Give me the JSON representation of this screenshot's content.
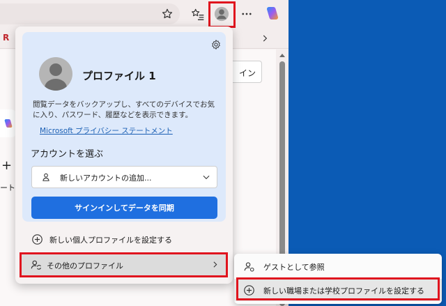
{
  "toolbar": {
    "bookmark_left_letter": "R"
  },
  "page": {
    "signin_fragment": "イン",
    "plus_symbol": "+",
    "side_fragment": "ート"
  },
  "flyout": {
    "profile_name": "プロファイル 1",
    "description": "閲覧データをバックアップし、すべてのデバイスでお気に入り、パスワード、履歴などを表示できます。",
    "privacy_link": "Microsoft プライバシー ステートメント",
    "account_label": "アカウントを選ぶ",
    "account_select_value": "新しいアカウントの追加...",
    "signin_button": "サインインしてデータを同期",
    "new_personal_profile": "新しい個人プロファイルを設定する",
    "other_profiles": "その他のプロファイル"
  },
  "submenu": {
    "browse_as_guest": "ゲストとして参照",
    "new_work_profile": "新しい職場または学校プロファイルを設定する"
  },
  "colors": {
    "accent": "#1f6fe0",
    "highlight_box": "#e0141e",
    "desktop": "#0b5bb5"
  }
}
